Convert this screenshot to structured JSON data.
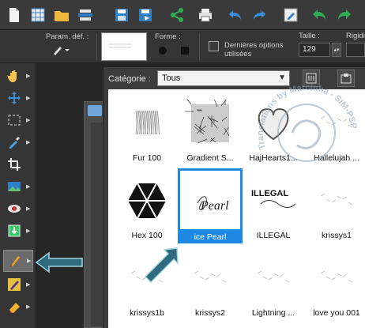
{
  "options": {
    "preset_label": "Param. déf. :",
    "shape_label": "Forme :",
    "last_options_label": "Dernières options utilisées",
    "size_label": "Taille :",
    "size_value": "129",
    "rigidity_label": "Rigidi"
  },
  "picker": {
    "category_label": "Catégorie :",
    "category_value": "Tous"
  },
  "brushes": [
    {
      "name": "Fur 100",
      "icon": "fur-texture"
    },
    {
      "name": "Gradient S...",
      "icon": "scribble-texture"
    },
    {
      "name": "HajHearts1...",
      "icon": "heart-sketch"
    },
    {
      "name": "Hallelujah ...",
      "icon": "faint-texture"
    },
    {
      "name": "Hex 100",
      "icon": "hexagon-shape"
    },
    {
      "name": "ice Pearl",
      "icon": "script-word",
      "selected": true,
      "thumb_text": "Pearl"
    },
    {
      "name": "ILLEGAL",
      "icon": "grunge-text",
      "thumb_text": "ILLEGAL"
    },
    {
      "name": "krissys1",
      "icon": "faint-texture"
    },
    {
      "name": "krissys1b",
      "icon": "faint-texture"
    },
    {
      "name": "krissys2",
      "icon": "faint-texture"
    },
    {
      "name": "Lightning ...",
      "icon": "faint-texture"
    },
    {
      "name": "love you 001",
      "icon": "faint-texture"
    }
  ],
  "watermark": {
    "text": "Translations by Marcinha - SIM-PSP"
  },
  "colors": {
    "selection": "#1e88e5",
    "annotation_arrow": "#2f6a7e",
    "toolbox_bg": "#353535"
  }
}
